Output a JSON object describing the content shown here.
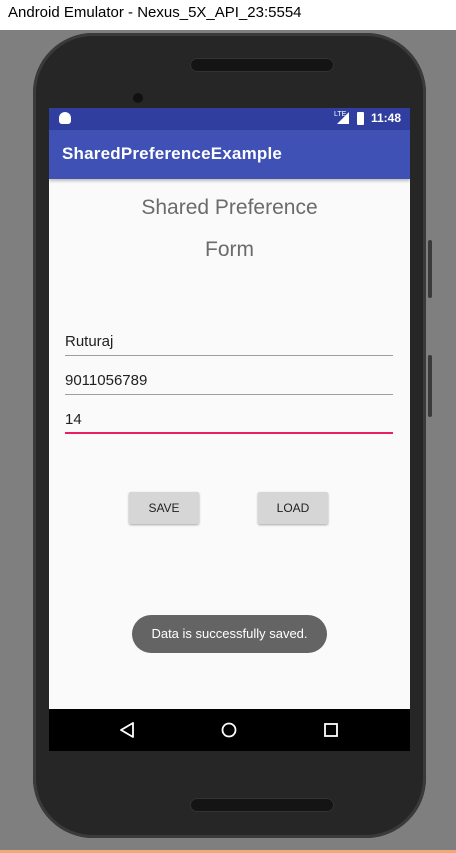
{
  "window": {
    "title": "Android Emulator - Nexus_5X_API_23:5554"
  },
  "status_bar": {
    "network_label": "LTE",
    "time": "11:48",
    "icons": [
      "android-icon",
      "signal-icon",
      "battery-icon"
    ]
  },
  "app_bar": {
    "title": "SharedPreferenceExample",
    "color": "#3f51b5",
    "status_color": "#303f9f"
  },
  "form": {
    "title_line1": "Shared Preference",
    "title_line2": "Form",
    "name_value": "Ruturaj",
    "phone_value": "9011056789",
    "age_value": "14",
    "accent_color": "#e91e63"
  },
  "buttons": {
    "save_label": "SAVE",
    "load_label": "LOAD"
  },
  "toast": {
    "message": "Data is successfully saved."
  },
  "nav_bar": {
    "icons": [
      "back-icon",
      "home-icon",
      "recents-icon"
    ]
  }
}
